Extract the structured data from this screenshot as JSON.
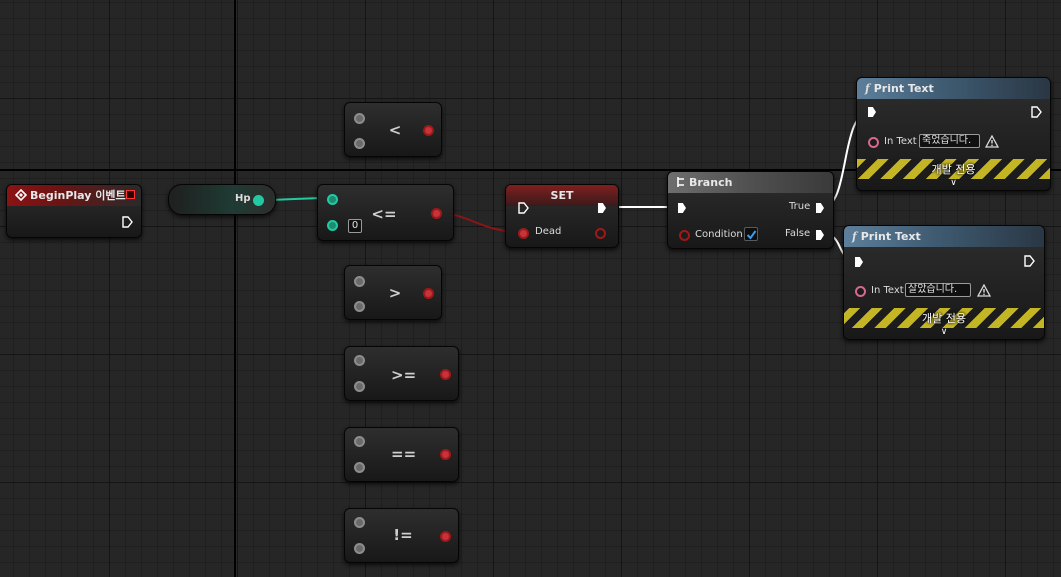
{
  "begin_play": {
    "title": "BeginPlay 이벤트"
  },
  "hp_var": {
    "label": "Hp"
  },
  "ops": {
    "lt": "<",
    "le": "<=",
    "gt": ">",
    "ge": ">=",
    "eq": "==",
    "ne": "!=",
    "le_value": "0"
  },
  "set_node": {
    "title": "SET",
    "var_label": "Dead"
  },
  "branch": {
    "title": "Branch",
    "condition_label": "Condition",
    "condition_checked": true,
    "true_label": "True",
    "false_label": "False"
  },
  "print_true": {
    "title": "Print Text",
    "in_text_label": "In Text",
    "in_text_value": "죽었습니다.",
    "dev_only": "개발 전용"
  },
  "print_false": {
    "title": "Print Text",
    "in_text_label": "In Text",
    "in_text_value": "살았습니다.",
    "dev_only": "개발 전용"
  },
  "colors": {
    "float_pin": "#23c9a0",
    "bool_pin": "#9c1a1a",
    "text_pin": "#d26b8e",
    "event_header": "#8b1313",
    "function_header": "#5d7f9b",
    "hazard_yellow": "#c4b524"
  },
  "icons": {
    "event": "diamond-event-icon",
    "branch": "branch-icon",
    "function": "function-icon",
    "warning": "warning-icon",
    "expand": "chevron-down-icon"
  }
}
